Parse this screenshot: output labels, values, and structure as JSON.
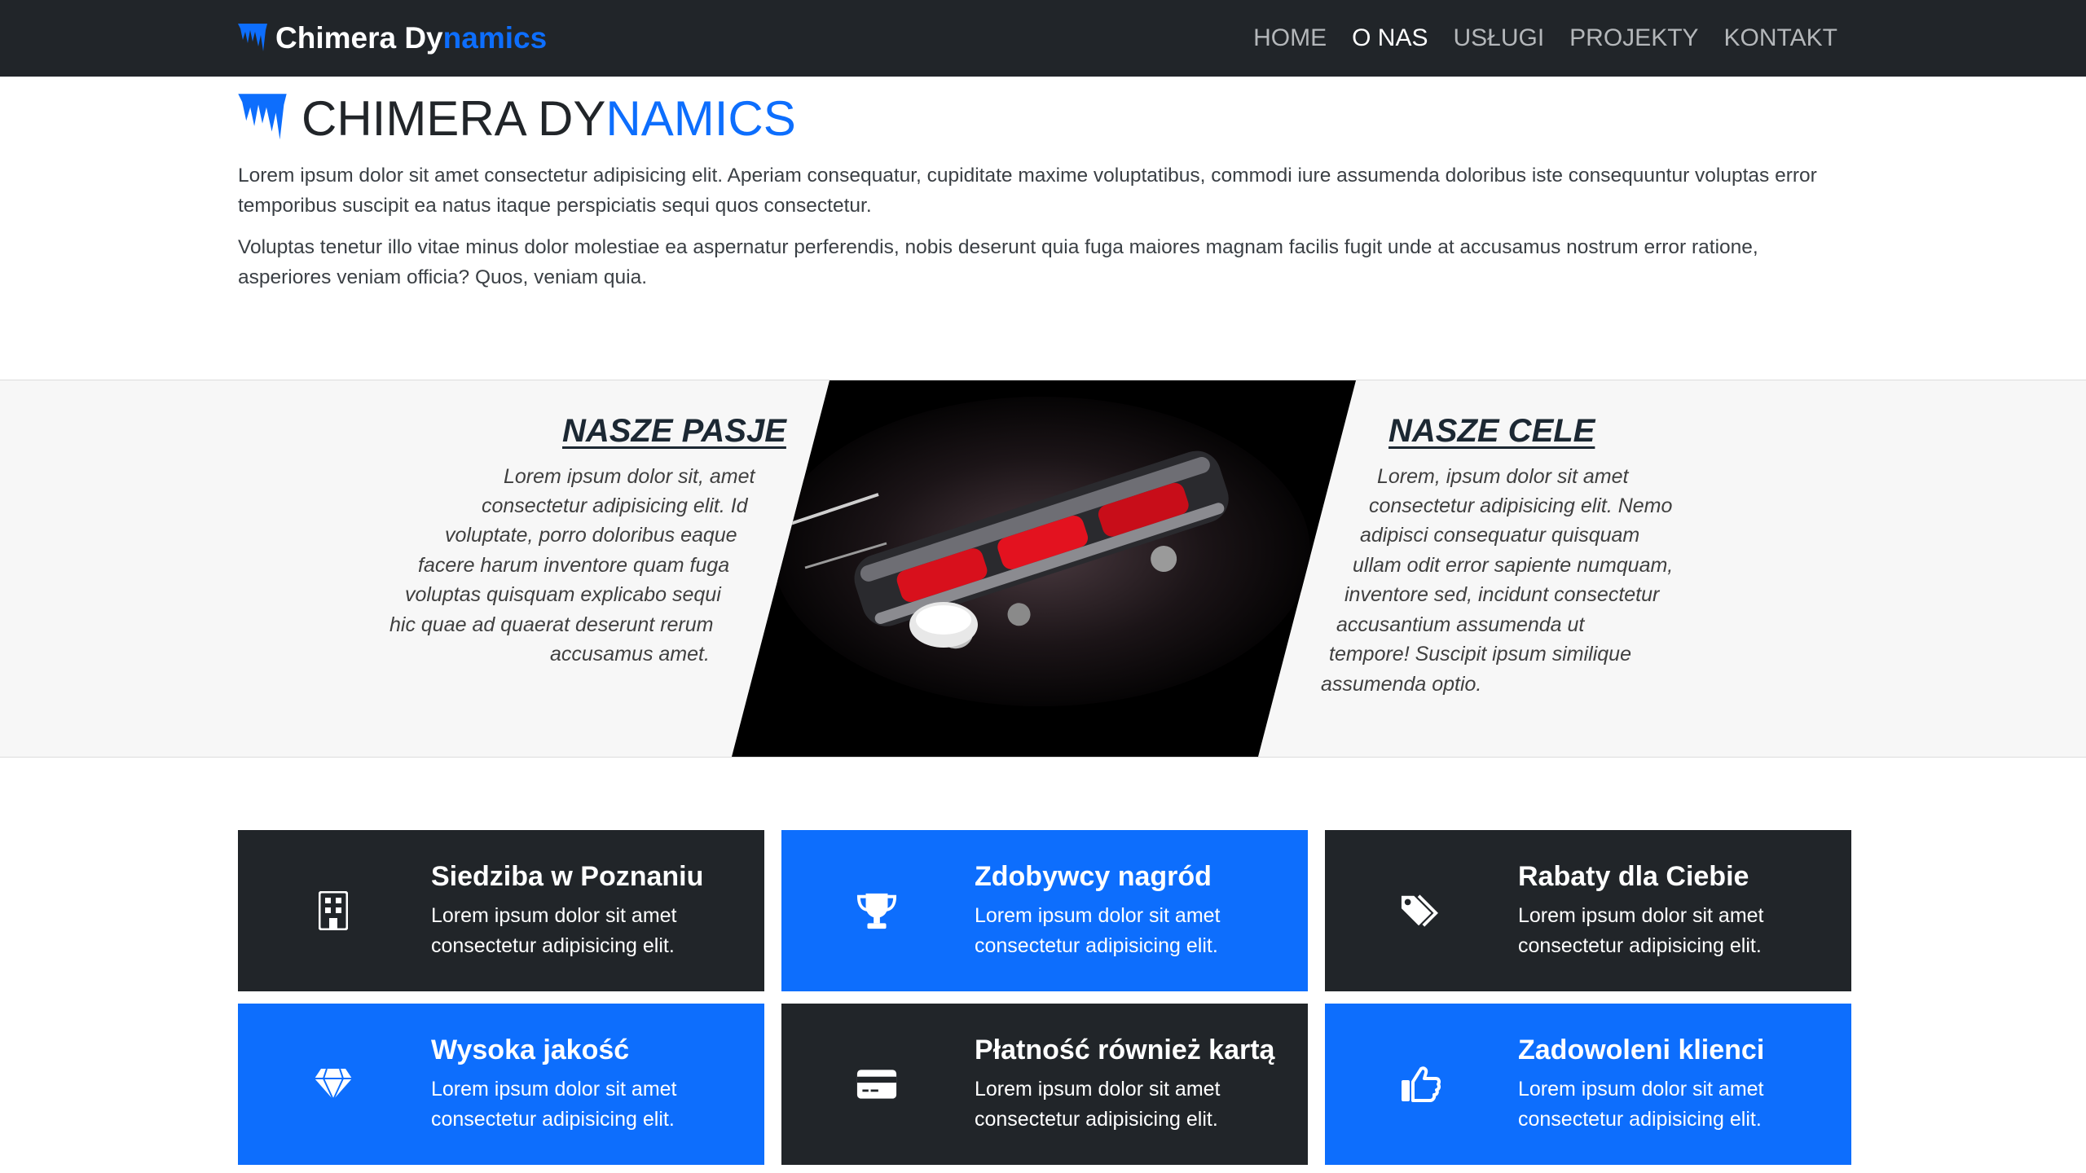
{
  "navbar": {
    "brand_part1": "Chimera Dy",
    "brand_part2": "namics",
    "links": [
      {
        "label": "HOME",
        "active": false
      },
      {
        "label": "O NAS",
        "active": true
      },
      {
        "label": "USŁUGI",
        "active": false
      },
      {
        "label": "PROJEKTY",
        "active": false
      },
      {
        "label": "KONTAKT",
        "active": false
      }
    ]
  },
  "intro": {
    "title_part1": "CHIMERA DY",
    "title_part2": "NAMICS",
    "paragraph1": "Lorem ipsum dolor sit amet consectetur adipisicing elit. Aperiam consequatur, cupiditate maxime voluptatibus, commodi iure assumenda doloribus iste consequuntur voluptas error temporibus suscipit ea natus itaque perspiciatis sequi quos consectetur.",
    "paragraph2": "Voluptas tenetur illo vitae minus dolor molestiae ea aspernatur perferendis, nobis deserunt quia fuga maiores magnam facilis fugit unde at accusamus nostrum error ratione, asperiores veniam officia? Quos, veniam quia."
  },
  "band": {
    "left_heading": "NASZE PASJE",
    "left_lines": [
      "Lorem ipsum dolor sit, amet",
      "consectetur adipisicing elit. Id",
      "voluptate, porro doloribus eaque",
      "facere harum inventore quam fuga",
      "voluptas quisquam explicabo sequi",
      "hic quae ad quaerat deserunt rerum",
      "accusamus amet."
    ],
    "right_heading": "NASZE CELE",
    "right_lines": [
      "Lorem, ipsum dolor sit amet",
      "consectetur adipisicing elit. Nemo",
      "adipisci consequatur quisquam",
      "ullam odit error sapiente numquam,",
      "inventore sed, incidunt consectetur",
      "accusantium assumenda ut",
      "tempore! Suscipit ipsum similique",
      "assumenda optio."
    ]
  },
  "cards": [
    {
      "title": "Siedziba w Poznaniu",
      "text": "Lorem ipsum dolor sit amet consectetur adipisicing elit.",
      "icon": "building-icon",
      "theme": "dark"
    },
    {
      "title": "Zdobywcy nagród",
      "text": "Lorem ipsum dolor sit amet consectetur adipisicing elit.",
      "icon": "trophy-icon",
      "theme": "blue"
    },
    {
      "title": "Rabaty dla Ciebie",
      "text": "Lorem ipsum dolor sit amet consectetur adipisicing elit.",
      "icon": "tags-icon",
      "theme": "dark"
    },
    {
      "title": "Wysoka jakość",
      "text": "Lorem ipsum dolor sit amet consectetur adipisicing elit.",
      "icon": "gem-icon",
      "theme": "blue"
    },
    {
      "title": "Płatność również kartą",
      "text": "Lorem ipsum dolor sit amet consectetur adipisicing elit.",
      "icon": "credit-card-icon",
      "theme": "dark"
    },
    {
      "title": "Zadowoleni klienci",
      "text": "Lorem ipsum dolor sit amet consectetur adipisicing elit.",
      "icon": "thumbs-up-icon",
      "theme": "blue"
    }
  ],
  "colors": {
    "accent": "#0d6efd",
    "dark": "#212529",
    "band_bg": "#f7f7f7"
  }
}
